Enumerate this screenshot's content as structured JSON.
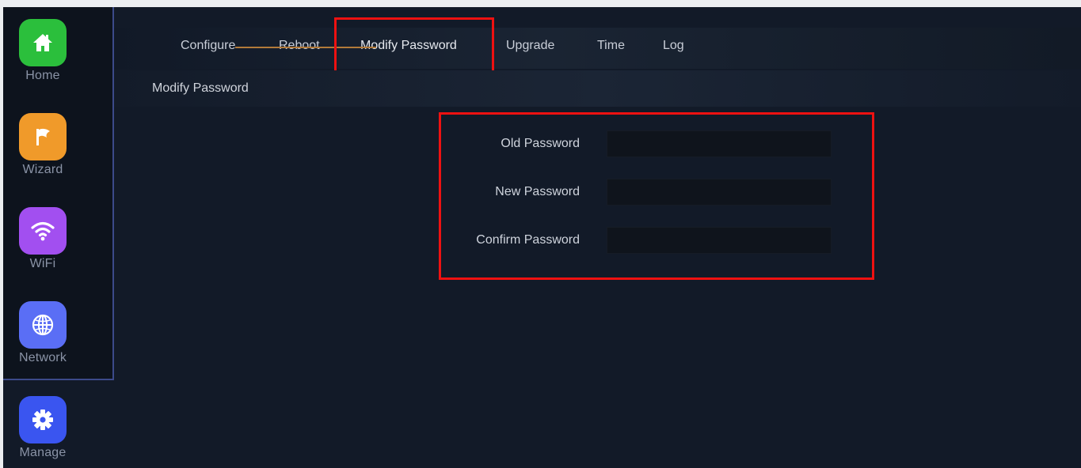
{
  "sidebar": {
    "items": [
      {
        "label": "Home",
        "icon": "home-icon",
        "color": "#2bbf3c"
      },
      {
        "label": "Wizard",
        "icon": "flag-icon",
        "color": "#f09a2a"
      },
      {
        "label": "WiFi",
        "icon": "wifi-icon",
        "color": "#a24ff0"
      },
      {
        "label": "Network",
        "icon": "globe-icon",
        "color": "#5a6ef5"
      },
      {
        "label": "Manage",
        "icon": "gear-icon",
        "color": "#3a55f0"
      }
    ]
  },
  "tabs": [
    {
      "label": "Configure"
    },
    {
      "label": "Reboot"
    },
    {
      "label": "Modify Password",
      "active": true
    },
    {
      "label": "Upgrade"
    },
    {
      "label": "Time"
    },
    {
      "label": "Log"
    }
  ],
  "section": {
    "title": "Modify Password"
  },
  "form": {
    "old_password": {
      "label": "Old Password",
      "value": ""
    },
    "new_password": {
      "label": "New Password",
      "value": ""
    },
    "confirm_password": {
      "label": "Confirm Password",
      "value": ""
    }
  },
  "colors": {
    "highlight": "#ee1111",
    "tab_underline": "#b27a3a",
    "sidebar_border": "#3c4a8a"
  }
}
